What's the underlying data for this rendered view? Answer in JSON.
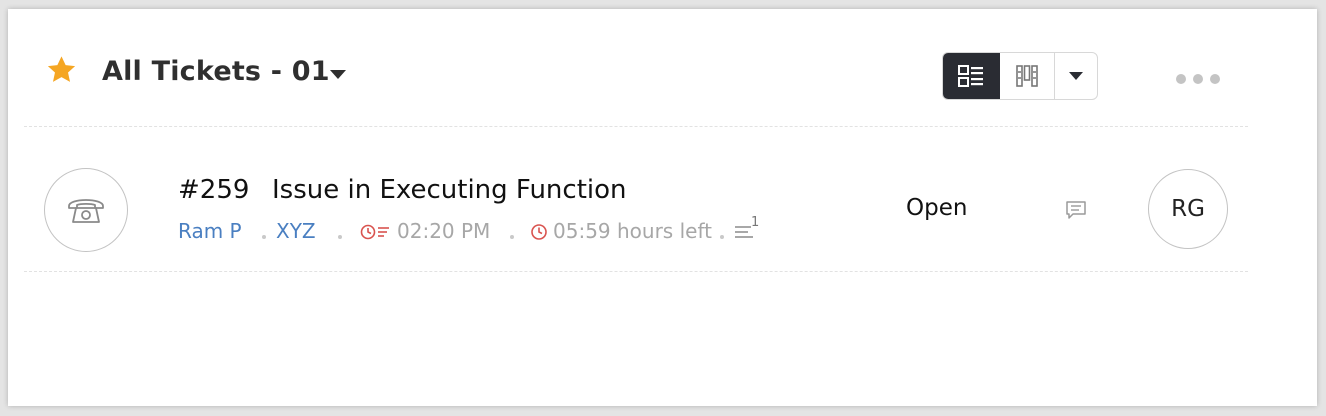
{
  "header": {
    "title": "All Tickets - 01",
    "star_color": "#f5a623",
    "view_switch": {
      "active": "list",
      "options": [
        "list-view-icon",
        "kanban-view-icon",
        "chevron-down-icon"
      ]
    }
  },
  "ticket": {
    "channel_icon": "phone-icon",
    "id": "#259",
    "subject": "Issue in Executing Function",
    "contact": "Ram P",
    "account": "XYZ",
    "created_time": "02:20 PM",
    "due_text": "05:59 hours left",
    "thread_count": "1",
    "status": "Open",
    "assignee_initials": "RG"
  },
  "colors": {
    "link": "#4a7fc1",
    "overdue_red": "#d9534f",
    "muted": "#a7a7a7",
    "dark": "#2a2c33"
  }
}
